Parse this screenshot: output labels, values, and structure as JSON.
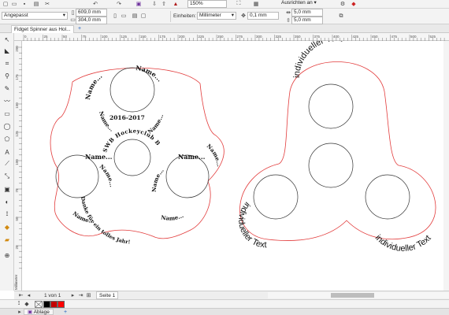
{
  "toolbar": {
    "zoom_value": "150%",
    "snap_label": "Ausrichten an",
    "icons": [
      "new-icon",
      "open-icon",
      "save-icon",
      "print-icon",
      "cut-icon",
      "undo-icon",
      "redo-icon",
      "search-icon",
      "import-icon",
      "export-icon",
      "publish-icon",
      "fullscreen-icon",
      "snap-icon",
      "settings-icon",
      "launch-icon"
    ]
  },
  "propertybar": {
    "page_size": "Angepasst",
    "width": "609,0 mm",
    "height": "304,0 mm",
    "units_label": "Einheiten:",
    "units_value": "Millimeter",
    "nudge": "0,1 mm",
    "dup_x": "5,0 mm",
    "dup_y": "5,0 mm"
  },
  "document": {
    "tab_label": "Fidget Spinner aus Hol...",
    "page_counter": "1 von 1",
    "page_tab": "Seite 1",
    "ruler_unit": "Millimeter",
    "docker_label": "Ablage"
  },
  "ruler": {
    "h_ticks": [
      "0",
      "25",
      "50",
      "75",
      "100",
      "125",
      "150",
      "175",
      "200",
      "225",
      "250",
      "275",
      "300",
      "325",
      "350",
      "375",
      "400",
      "425",
      "450",
      "475",
      "500",
      "525"
    ],
    "v_ticks": [
      "200",
      "175",
      "150",
      "125",
      "100",
      "75",
      "50",
      "25",
      "0"
    ]
  },
  "tools": [
    "pick-tool-icon",
    "shape-tool-icon",
    "crop-tool-icon",
    "zoom-tool-icon",
    "freehand-tool-icon",
    "artistic-media-icon",
    "rectangle-tool-icon",
    "ellipse-tool-icon",
    "polygon-tool-icon",
    "text-tool-icon",
    "parallel-dimension-icon",
    "connector-tool-icon",
    "drop-shadow-icon",
    "transparency-icon",
    "color-eyedropper-icon",
    "interactive-fill-icon",
    "smart-fill-icon",
    "add-tool-icon"
  ],
  "design_left": {
    "outline_color": "#e23b3b",
    "name_text": "Name...",
    "year_text": "2016-2017",
    "club_text": "SWB Hockeyclub Bremen",
    "thanks_text": "Danke für ein tolles Jahr!"
  },
  "design_right": {
    "outline_color": "#e23b3b",
    "label_text": "individueller Text"
  },
  "palette": {
    "colors": [
      "#000000",
      "#c40000",
      "#ff0000"
    ]
  }
}
